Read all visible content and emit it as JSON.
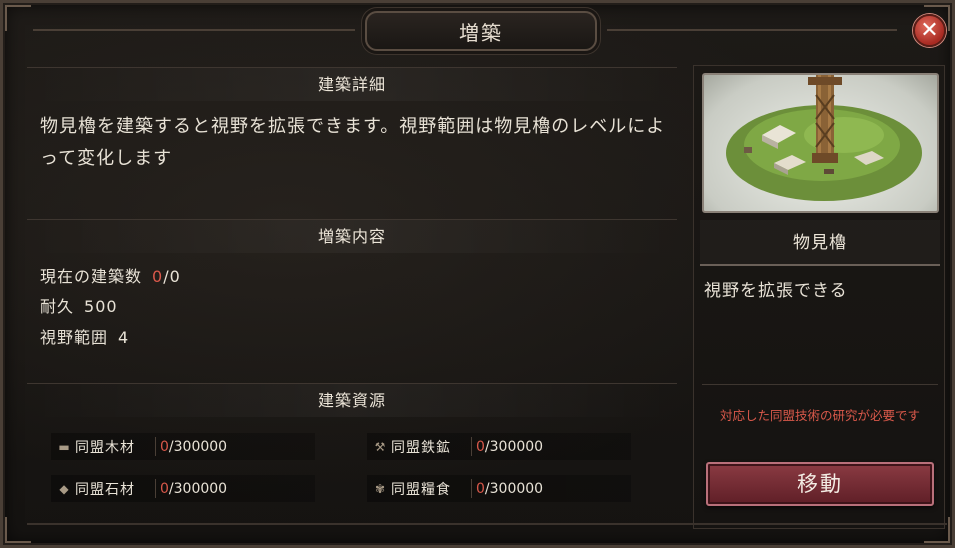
{
  "window": {
    "title": "増築"
  },
  "left": {
    "details": {
      "heading": "建築詳細",
      "description": "物見櫓を建築すると視野を拡張できます。視野範囲は物見櫓のレベルによって変化します"
    },
    "content": {
      "heading": "増築内容",
      "stats": [
        {
          "label": "現在の建築数",
          "value_current": "0",
          "value_rest": "/0"
        },
        {
          "label": "耐久",
          "value": "500"
        },
        {
          "label": "視野範囲",
          "value": "4"
        }
      ]
    },
    "resources": {
      "heading": "建築資源",
      "items": [
        {
          "icon": "wood-icon",
          "glyph": "▬",
          "name": "同盟木材",
          "have": "0",
          "need": "/300000"
        },
        {
          "icon": "iron-icon",
          "glyph": "⚒",
          "name": "同盟鉄鉱",
          "have": "0",
          "need": "/300000"
        },
        {
          "icon": "stone-icon",
          "glyph": "◆",
          "name": "同盟石材",
          "have": "0",
          "need": "/300000"
        },
        {
          "icon": "food-icon",
          "glyph": "✾",
          "name": "同盟糧食",
          "have": "0",
          "need": "/300000"
        }
      ]
    }
  },
  "right": {
    "building_name": "物見櫓",
    "effect": "視野を拡張できる",
    "requirement": "対応した同盟技術の研究が必要です",
    "move_button": "移動"
  },
  "colors": {
    "accent_red": "#d8584a",
    "button": "#8a3a42"
  }
}
